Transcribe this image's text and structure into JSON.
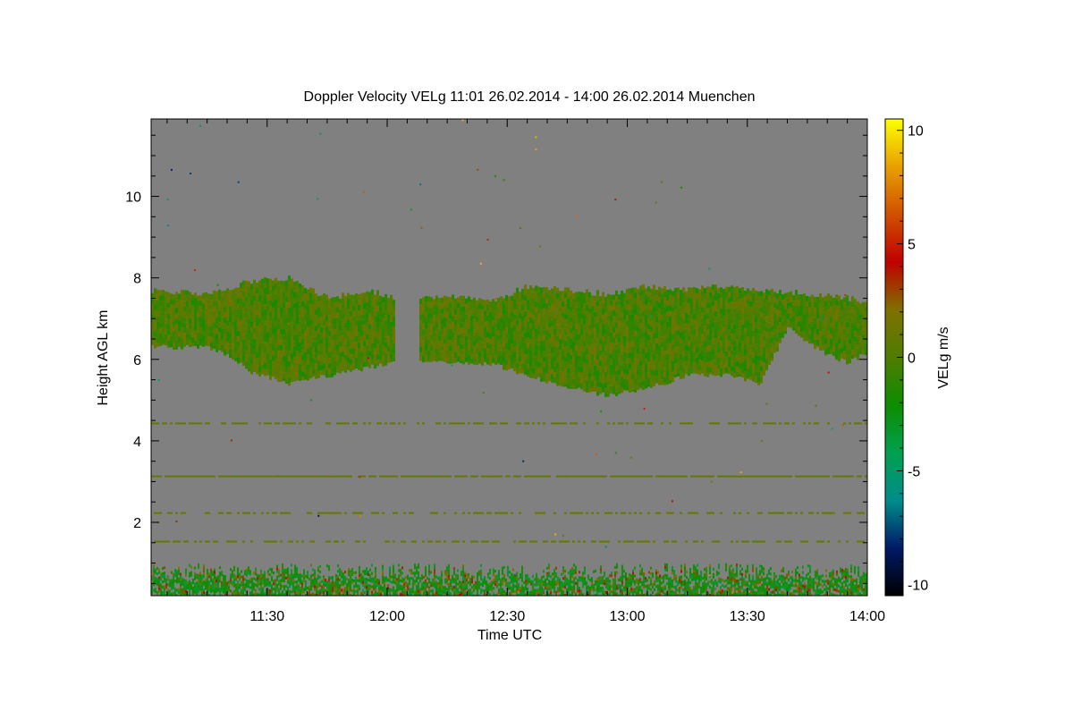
{
  "chart_data": {
    "type": "heatmap",
    "title": "Doppler Velocity VELg   11:01 26.02.2014 - 14:00 26.02.2014 Muenchen",
    "xlabel": "Time UTC",
    "ylabel": "Height AGL km",
    "colorbar_label": "VELg m/s",
    "x_range": [
      "11:01",
      "14:00"
    ],
    "x_ticks": [
      "11:30",
      "12:00",
      "12:30",
      "13:00",
      "13:30",
      "14:00"
    ],
    "y_range_km": [
      0.2,
      11.9
    ],
    "y_ticks": [
      2,
      4,
      6,
      8,
      10
    ],
    "colorbar_range": [
      -10.5,
      10.5
    ],
    "colorbar_ticks": [
      10,
      5,
      0,
      -5,
      -10
    ],
    "background_color": "#808080",
    "colormap": [
      "#000000",
      "#001a66",
      "#008c8c",
      "#00a050",
      "#0d8c00",
      "#4f7d00",
      "#807000",
      "#c00000",
      "#d05000",
      "#e8a000",
      "#ffff00"
    ],
    "cloud_layer": {
      "description_free": true,
      "upper_boundary_km": [
        [
          "11:01",
          7.7
        ],
        [
          "11:15",
          7.6
        ],
        [
          "11:25",
          7.9
        ],
        [
          "11:35",
          8.0
        ],
        [
          "11:45",
          7.5
        ],
        [
          "11:55",
          7.7
        ],
        [
          "12:05",
          7.4
        ],
        [
          "12:15",
          7.6
        ],
        [
          "12:25",
          7.4
        ],
        [
          "12:35",
          7.8
        ],
        [
          "12:45",
          7.7
        ],
        [
          "12:55",
          7.6
        ],
        [
          "13:05",
          7.8
        ],
        [
          "13:15",
          7.7
        ],
        [
          "13:25",
          7.8
        ],
        [
          "13:35",
          7.7
        ],
        [
          "13:45",
          7.6
        ],
        [
          "13:55",
          7.5
        ],
        [
          "14:00",
          7.4
        ]
      ],
      "lower_boundary_km": [
        [
          "11:01",
          6.3
        ],
        [
          "11:15",
          6.3
        ],
        [
          "11:22",
          6.0
        ],
        [
          "11:25",
          5.7
        ],
        [
          "11:35",
          5.4
        ],
        [
          "11:45",
          5.6
        ],
        [
          "11:55",
          5.8
        ],
        [
          "12:05",
          6.0
        ],
        [
          "12:15",
          5.9
        ],
        [
          "12:25",
          5.9
        ],
        [
          "12:35",
          5.6
        ],
        [
          "12:45",
          5.3
        ],
        [
          "12:55",
          5.1
        ],
        [
          "13:05",
          5.3
        ],
        [
          "13:15",
          5.6
        ],
        [
          "13:25",
          5.6
        ],
        [
          "13:33",
          5.4
        ],
        [
          "13:40",
          6.8
        ],
        [
          "13:48",
          6.2
        ],
        [
          "13:55",
          5.9
        ],
        [
          "14:00",
          6.2
        ]
      ]
    },
    "boundary_layer_top_km": 0.8,
    "noise_layers_km": [
      4.45,
      3.15,
      2.25,
      1.55
    ]
  }
}
